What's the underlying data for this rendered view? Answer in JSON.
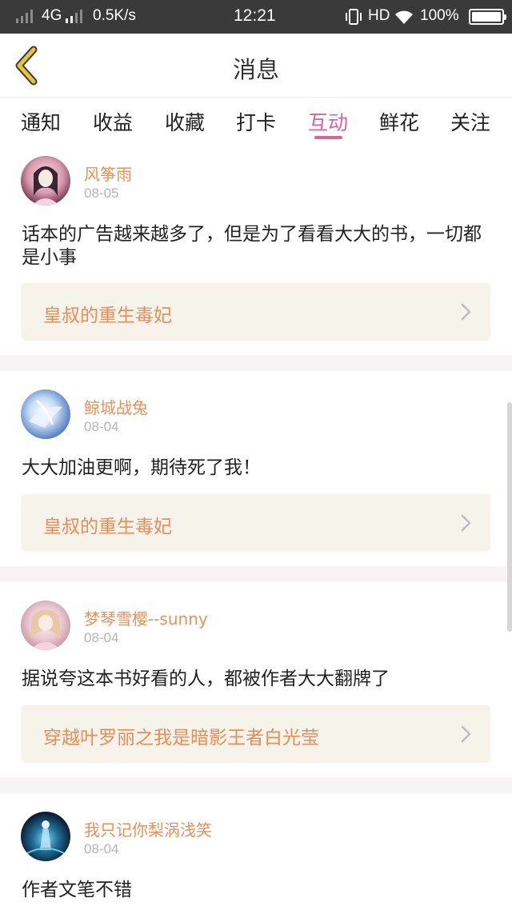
{
  "status_bar": {
    "network": "4G",
    "speed": "0.5K/s",
    "time": "12:21",
    "hd": "HD",
    "battery": "100%",
    "battery_level": 1.0
  },
  "header": {
    "title": "消息",
    "back_icon": "chevron-left-icon",
    "back_color": "#e8c43a"
  },
  "tabs": [
    {
      "label": "通知",
      "active": false
    },
    {
      "label": "收益",
      "active": false
    },
    {
      "label": "收藏",
      "active": false
    },
    {
      "label": "打卡",
      "active": false
    },
    {
      "label": "互动",
      "active": true
    },
    {
      "label": "鲜花",
      "active": false
    },
    {
      "label": "关注",
      "active": false
    }
  ],
  "colors": {
    "accent": "#e2609a",
    "username": "#e8915a",
    "book_title": "#ec8c55",
    "card_bg": "#f5f3ea"
  },
  "messages": [
    {
      "username": "风筝雨",
      "date": "08-05",
      "text": "话本的广告越来越多了，但是为了看看大大的书，一切都是小事",
      "book": "皇叔的重生毒妃"
    },
    {
      "username": "鲸城战兔",
      "date": "08-04",
      "text": "大大加油更啊，期待死了我！",
      "book": "皇叔的重生毒妃"
    },
    {
      "username": "梦琴雪樱--sunny",
      "date": "08-04",
      "text": "据说夸这本书好看的人，都被作者大大翻牌了",
      "book": "穿越叶罗丽之我是暗影王者白光莹"
    },
    {
      "username": "我只记你梨涡浅笑",
      "date": "08-04",
      "text": "作者文笔不错",
      "book": ""
    }
  ]
}
